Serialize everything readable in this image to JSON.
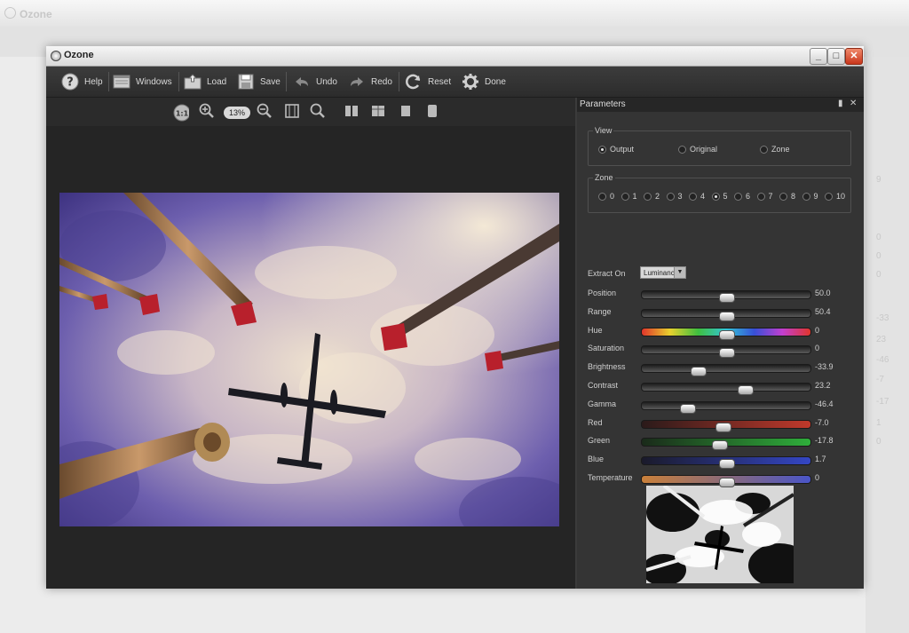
{
  "background_app": {
    "title": "Ozone",
    "ghost_values": [
      "9",
      "0",
      "0",
      "0",
      "-33",
      "23",
      "-46",
      "-7",
      "-17",
      "1",
      "0"
    ]
  },
  "window": {
    "title": "Ozone",
    "controls": [
      "_",
      "□",
      "✕"
    ]
  },
  "toolbar": {
    "help": "Help",
    "windows": "Windows",
    "load": "Load",
    "save": "Save",
    "undo": "Undo",
    "redo": "Redo",
    "reset": "Reset",
    "done": "Done"
  },
  "view_toolbar": {
    "one_to_one": "1:1",
    "zoom_level": "13%"
  },
  "panel": {
    "title": "Parameters",
    "view_group": {
      "legend": "View",
      "options": [
        {
          "label": "Output",
          "selected": true
        },
        {
          "label": "Original",
          "selected": false
        },
        {
          "label": "Zone",
          "selected": false
        }
      ]
    },
    "zone_group": {
      "legend": "Zone",
      "options": [
        {
          "label": "0",
          "selected": false
        },
        {
          "label": "1",
          "selected": false
        },
        {
          "label": "2",
          "selected": false
        },
        {
          "label": "3",
          "selected": false
        },
        {
          "label": "4",
          "selected": false
        },
        {
          "label": "5",
          "selected": true
        },
        {
          "label": "6",
          "selected": false
        },
        {
          "label": "7",
          "selected": false
        },
        {
          "label": "8",
          "selected": false
        },
        {
          "label": "9",
          "selected": false
        },
        {
          "label": "10",
          "selected": false
        }
      ]
    },
    "extract_on": {
      "label": "Extract On",
      "value": "Luminance"
    },
    "params": [
      {
        "label": "Position",
        "value": "50.0",
        "level": 0.5,
        "track": "gray"
      },
      {
        "label": "Range",
        "value": "50.4",
        "level": 0.5,
        "track": "gray"
      },
      {
        "label": "Hue",
        "value": "0",
        "level": 0.5,
        "track": "hue"
      },
      {
        "label": "Saturation",
        "value": "0",
        "level": 0.5,
        "track": "gray"
      },
      {
        "label": "Brightness",
        "value": "-33.9",
        "level": 0.33,
        "track": "gray"
      },
      {
        "label": "Contrast",
        "value": "23.2",
        "level": 0.61,
        "track": "gray"
      },
      {
        "label": "Gamma",
        "value": "-46.4",
        "level": 0.27,
        "track": "gray"
      },
      {
        "label": "Red",
        "value": "-7.0",
        "level": 0.48,
        "track": "red"
      },
      {
        "label": "Green",
        "value": "-17.8",
        "level": 0.46,
        "track": "green"
      },
      {
        "label": "Blue",
        "value": "1.7",
        "level": 0.5,
        "track": "blue"
      },
      {
        "label": "Temperature",
        "value": "0",
        "level": 0.5,
        "track": "temperature"
      }
    ]
  },
  "colors": {
    "window_bg": "#2d2d2d",
    "panel_bg": "#343434",
    "sky_purple": "#5a4fa6",
    "cloud_cream": "#f0dcc0",
    "close_red": "#c9361b"
  }
}
